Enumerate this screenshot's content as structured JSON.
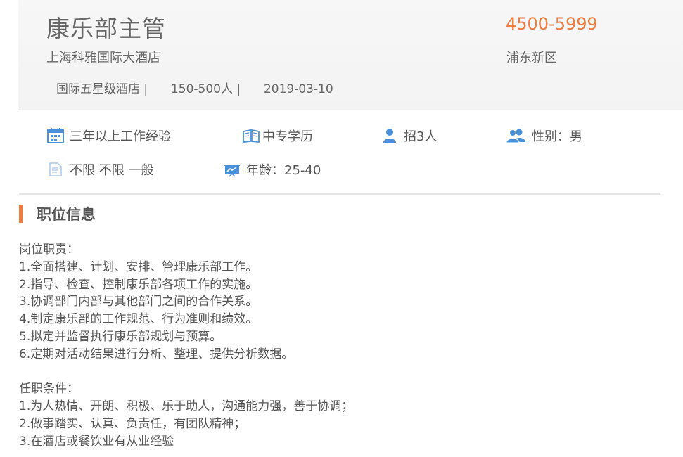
{
  "job": {
    "title": "康乐部主管",
    "company": "上海科雅国际大酒店",
    "salary": "4500-5999",
    "location": "浦东新区",
    "meta": [
      "国际五星级酒店 |",
      "150-500人 |",
      "2019-03-10"
    ]
  },
  "requirements": [
    {
      "icon": "calendar-icon",
      "text": "三年以上工作经验"
    },
    {
      "icon": "book-icon",
      "text": "中专学历"
    },
    {
      "icon": "person-icon",
      "text": "招3人"
    },
    {
      "icon": "people-icon",
      "text": "性别：男"
    },
    {
      "icon": "document-icon",
      "text": "不限 不限 一般"
    },
    {
      "icon": "presentation-icon",
      "text": "年龄：25-40"
    }
  ],
  "section": {
    "title": "职位信息"
  },
  "description": {
    "duties_heading": "岗位职责：",
    "duties": [
      "1.全面搭建、计划、安排、管理康乐部工作。",
      "2.指导、检查、控制康乐部各项工作的实施。",
      "3.协调部门内部与其他部门之间的合作关系。",
      "4.制定康乐部的工作规范、行为准则和绩效。",
      "5.拟定并监督执行康乐部规划与预算。",
      "6.定期对活动结果进行分析、整理、提供分析数据。"
    ],
    "conditions_heading": "任职条件：",
    "conditions": [
      "1.为人热情、开朗、积极、乐于助人，沟通能力强，善于协调；",
      "2.做事踏实、认真、负责任，有团队精神；",
      "3.在酒店或餐饮业有从业经验"
    ]
  },
  "colors": {
    "accent": "#f07b3f",
    "icon_blue": "#4a90d9",
    "text": "#555555"
  }
}
